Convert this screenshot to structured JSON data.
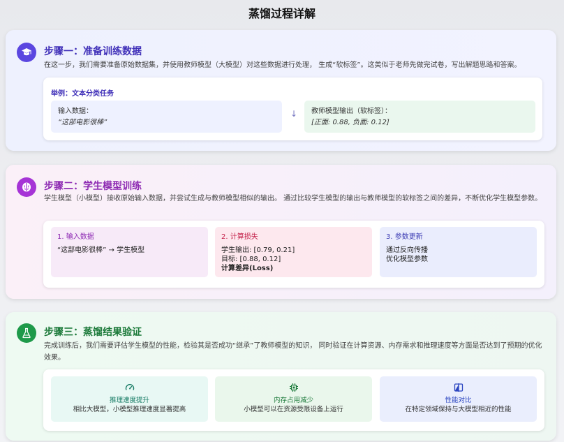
{
  "page_title": "蒸馏过程详解",
  "step1": {
    "icon": "graduation-cap-icon",
    "title": "步骤一：准备训练数据",
    "desc": "在这一步，我们需要准备原始数据集，并使用教师模型（大模型）对这些数据进行处理， 生成“软标签”。这类似于老师先做完试卷，写出解题思路和答案。",
    "example_title": "举例：文本分类任务",
    "input_label": "输入数据：",
    "input_value": "“这部电影很棒”",
    "arrow": "↓",
    "output_label": "教师模型输出（软标签）：",
    "output_value": "[正面: 0.88, 负面: 0.12]"
  },
  "step2": {
    "icon": "brain-icon",
    "title": "步骤二：学生模型训练",
    "desc": "学生模型（小模型）接收原始输入数据，并尝试生成与教师模型相似的输出。 通过比较学生模型的输出与教师模型的软标签之间的差异，不断优化学生模型参数。",
    "sub1": {
      "title": "1. 输入数据",
      "line1": "“这部电影很棒” → 学生模型"
    },
    "sub2": {
      "title": "2. 计算损失",
      "line1": "学生输出: [0.79, 0.21]",
      "line2": "目标: [0.88, 0.12]",
      "line3": "计算差异(Loss)"
    },
    "sub3": {
      "title": "3. 参数更新",
      "line1": "通过反向传播",
      "line2": "优化模型参数"
    }
  },
  "step3": {
    "icon": "flask-icon",
    "title": "步骤三：蒸馏结果验证",
    "desc": "完成训练后，我们需要评估学生模型的性能，检验其是否成功“继承”了教师模型的知识， 同时验证在计算资源、内存需求和推理速度等方面是否达到了预期的优化效果。",
    "results": [
      {
        "icon": "speedometer-icon",
        "title": "推理速度提升",
        "desc": "相比大模型，小模型推理速度显著提高"
      },
      {
        "icon": "chip-icon",
        "title": "内存占用减少",
        "desc": "小模型可以在资源受限设备上运行"
      },
      {
        "icon": "compare-icon",
        "title": "性能对比",
        "desc": "在特定领域保持与大模型相近的性能"
      }
    ]
  }
}
